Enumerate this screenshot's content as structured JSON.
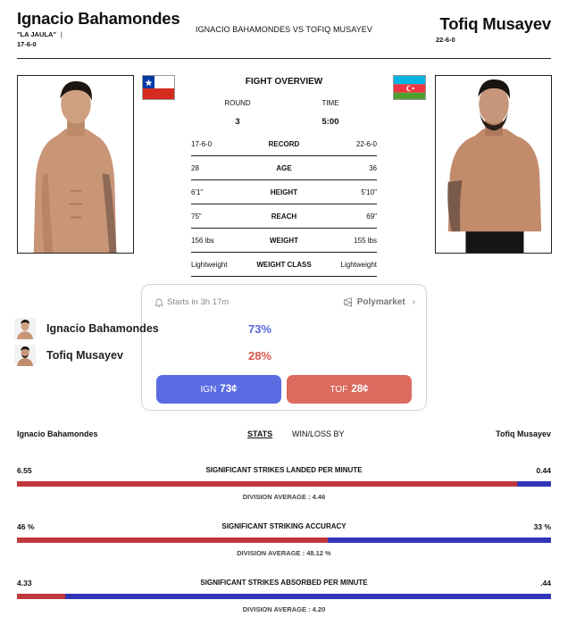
{
  "fighter1": {
    "name": "Ignacio Bahamondes",
    "nickname": "\"LA JAULA\"",
    "record": "17-6-0",
    "flag_colors": {
      "top": "#ffffff",
      "bottom": "#d52b1e",
      "canton": "#0039a6"
    }
  },
  "fighter2": {
    "name": "Tofiq Musayev",
    "record": "22-6-0",
    "flag_colors": {
      "top": "#00b5e2",
      "middle": "#ef3340",
      "bottom": "#509e2f"
    }
  },
  "matchup": "IGNACIO BAHAMONDES VS TOFIQ MUSAYEV",
  "overview": {
    "title": "FIGHT OVERVIEW",
    "round_label": "ROUND",
    "round_value": "3",
    "time_label": "TIME",
    "time_value": "5:00",
    "rows": [
      {
        "left": "17-6-0",
        "label": "RECORD",
        "right": "22-6-0"
      },
      {
        "left": "28",
        "label": "AGE",
        "right": "36"
      },
      {
        "left": "6'1\"",
        "label": "HEIGHT",
        "right": "5'10\""
      },
      {
        "left": "75\"",
        "label": "REACH",
        "right": "69\""
      },
      {
        "left": "156 lbs",
        "label": "WEIGHT",
        "right": "155 lbs"
      },
      {
        "left": "Lightweight",
        "label": "WEIGHT CLASS",
        "right": "Lightweight"
      }
    ]
  },
  "market": {
    "starts": "Starts in 3h 17m",
    "provider": "Polymarket",
    "candidates": [
      {
        "name": "Ignacio Bahamondes",
        "pct": "73%"
      },
      {
        "name": "Tofiq Musayev",
        "pct": "28%"
      }
    ],
    "buttons": [
      {
        "prefix": "IGN",
        "price": "73¢"
      },
      {
        "prefix": "TOF",
        "price": "28¢"
      }
    ],
    "colors": {
      "blue": "#5b6ce3",
      "red": "#dc6a5f"
    }
  },
  "stats": {
    "left_name": "Ignacio Bahamondes",
    "right_name": "Tofiq Musayev",
    "tab_stats": "STATS",
    "tab_winloss": "WIN/LOSS BY",
    "items": [
      {
        "left": "6.55",
        "label": "SIGNIFICANT STRIKES LANDED PER MINUTE",
        "right": "0.44",
        "share": 0.937,
        "avg": "DIVISION AVERAGE : 4.46"
      },
      {
        "left": "46 %",
        "label": "SIGNIFICANT STRIKING ACCURACY",
        "right": "33 %",
        "share": 0.582,
        "avg": "DIVISION AVERAGE : 48.12 %"
      },
      {
        "left": "4.33",
        "label": "SIGNIFICANT STRIKES ABSORBED PER MINUTE",
        "right": ".44",
        "share": 0.091,
        "avg": "DIVISION AVERAGE : 4.20"
      }
    ],
    "colors": {
      "left": "#c0383d",
      "right": "#3236b6"
    }
  }
}
